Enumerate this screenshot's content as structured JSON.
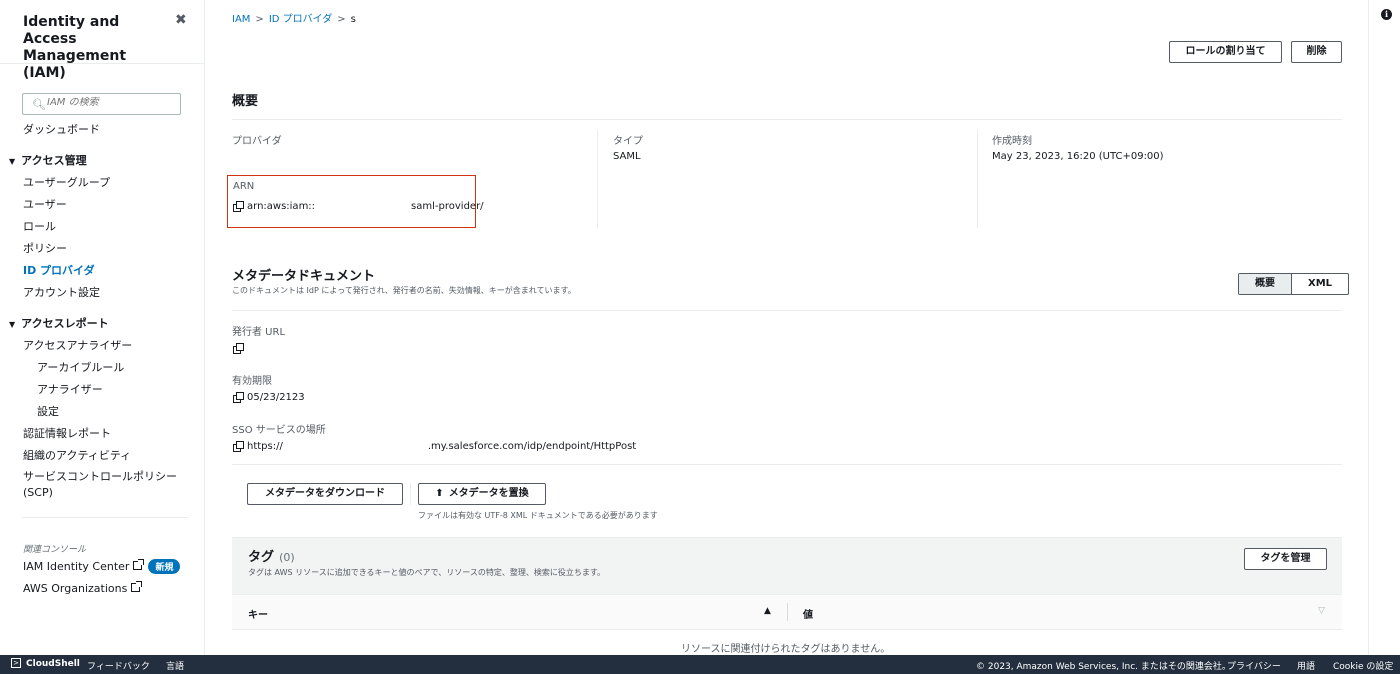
{
  "sidebar": {
    "title": "Identity and Access Management (IAM)",
    "search_placeholder": "IAM の検索",
    "dashboard": "ダッシュボード",
    "access_management": {
      "header": "アクセス管理",
      "items": [
        "ユーザーグループ",
        "ユーザー",
        "ロール",
        "ポリシー",
        "ID プロバイダ",
        "アカウント設定"
      ],
      "active_index": 4
    },
    "access_reports": {
      "header": "アクセスレポート",
      "analyzer": "アクセスアナライザー",
      "sub_items": [
        "アーカイブルール",
        "アナライザー",
        "設定"
      ],
      "items": [
        "認証情報レポート",
        "組織のアクティビティ",
        "サービスコントロールポリシー (SCP)"
      ]
    },
    "related_consoles": "関連コンソール",
    "identity_center": "IAM Identity Center",
    "new_badge": "新規",
    "organizations": "AWS Organizations"
  },
  "breadcrumb": [
    "IAM",
    "ID プロバイダ",
    "s"
  ],
  "actions": {
    "assign_role": "ロールの割り当て",
    "delete": "削除"
  },
  "summary": {
    "title": "概要",
    "provider_label": "プロバイダ",
    "provider_value": "",
    "type_label": "タイプ",
    "type_value": "SAML",
    "created_label": "作成時刻",
    "created_value": "May 23, 2023, 16:20 (UTC+09:00)",
    "arn_label": "ARN",
    "arn_prefix": "arn:aws:iam::",
    "arn_suffix": "saml-provider/"
  },
  "metadata": {
    "title": "メタデータドキュメント",
    "description": "このドキュメントは IdP によって発行され、発行者の名前、失効情報、キーが含まれています。",
    "tabs": [
      "概要",
      "XML"
    ],
    "issuer_label": "発行者 URL",
    "issuer_value": "",
    "expiry_label": "有効期限",
    "expiry_value": "05/23/2123",
    "sso_label": "SSO サービスの場所",
    "sso_prefix": "https://",
    "sso_suffix": ".my.salesforce.com/idp/endpoint/HttpPost",
    "download_button": "メタデータをダウンロード",
    "replace_button": "メタデータを置換",
    "replace_hint": "ファイルは有効な UTF-8 XML ドキュメントである必要があります"
  },
  "tags": {
    "title": "タグ",
    "count": "(0)",
    "description": "タグは AWS リソースに追加できるキーと値のペアで、リソースの特定、整理、検索に役立ちます。",
    "manage_button": "タグを管理",
    "columns": [
      "キー",
      "値"
    ],
    "empty_text": "リソースに関連付けられたタグはありません。"
  },
  "footer": {
    "cloudshell": "CloudShell",
    "feedback": "フィードバック",
    "language": "言語",
    "copyright": "© 2023, Amazon Web Services, Inc. またはその関連会社。",
    "privacy": "プライバシー",
    "terms": "用語",
    "cookie": "Cookie の設定"
  },
  "colors": {
    "link": "#0073bb",
    "highlight_border": "#d13212",
    "footer_bg": "#232f3e"
  }
}
